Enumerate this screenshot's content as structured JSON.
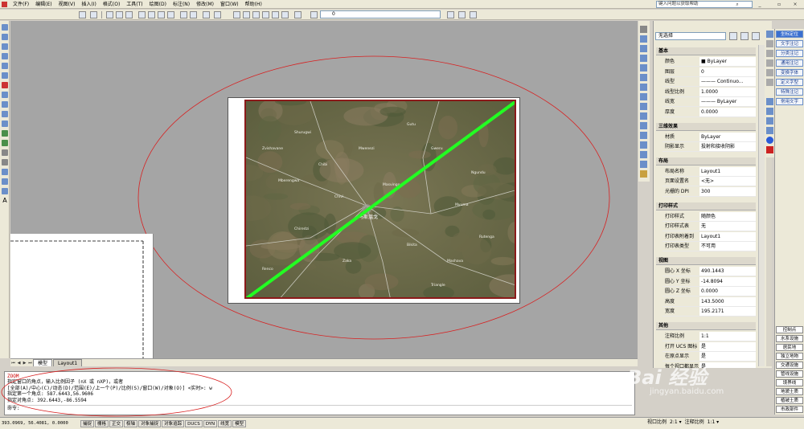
{
  "menu": {
    "items": [
      "文件(F)",
      "编辑(E)",
      "视图(V)",
      "插入(I)",
      "格式(O)",
      "工具(T)",
      "绘图(D)",
      "标注(N)",
      "修改(M)",
      "窗口(W)",
      "帮助(H)"
    ],
    "help_placeholder": "键入问题以获取帮助"
  },
  "toolbar": {
    "layer_value": "0"
  },
  "map": {
    "labels": [
      "Zvishavane",
      "Shurugwi",
      "Mberengwa",
      "Chivi",
      "Masvingo",
      "Gweru",
      "Mvuma",
      "Bikita",
      "Zaka",
      "Chiredzi",
      "Ngundu",
      "Renco",
      "Gutu",
      "Mashava",
      "Mwenezi",
      "Rutenga",
      "Chibi",
      "Triangle"
    ],
    "city_label": "马斯温戈",
    "line_color": "#22ff22",
    "frame_color": "#8b1a1a"
  },
  "props": {
    "selection": "无选择",
    "sections": {
      "basic": "基本",
      "3d": "三维效果",
      "layout": "布局",
      "plot": "打印样式",
      "view": "视图",
      "other": "其他"
    },
    "basic": [
      {
        "k": "颜色",
        "v": "■ ByLayer"
      },
      {
        "k": "图层",
        "v": "0"
      },
      {
        "k": "线型",
        "v": "——— Continuo..."
      },
      {
        "k": "线型比例",
        "v": "1.0000"
      },
      {
        "k": "线宽",
        "v": "——— ByLayer"
      },
      {
        "k": "厚度",
        "v": "0.0000"
      }
    ],
    "d3": [
      {
        "k": "材质",
        "v": "ByLayer"
      },
      {
        "k": "阴影显示",
        "v": "投射和接收阴影"
      }
    ],
    "layout": [
      {
        "k": "布局名称",
        "v": "Layout1"
      },
      {
        "k": "页面设置名",
        "v": "<无>"
      },
      {
        "k": "光栅的 DPI",
        "v": "300"
      }
    ],
    "plot": [
      {
        "k": "打印样式",
        "v": "随颜色"
      },
      {
        "k": "打印样式表",
        "v": "无"
      },
      {
        "k": "打印表附着到",
        "v": "Layout1"
      },
      {
        "k": "打印表类型",
        "v": "不可用"
      }
    ],
    "view": [
      {
        "k": "圆心 X 坐标",
        "v": "490.1443"
      },
      {
        "k": "圆心 Y 坐标",
        "v": "-14.8094"
      },
      {
        "k": "圆心 Z 坐标",
        "v": "0.0000"
      },
      {
        "k": "高度",
        "v": "143.5000"
      },
      {
        "k": "宽度",
        "v": "195.2171"
      }
    ],
    "other": [
      {
        "k": "注释比例",
        "v": "1:1"
      },
      {
        "k": "打开 UCS 图标",
        "v": "是"
      },
      {
        "k": "在原点显示",
        "v": "是"
      },
      {
        "k": "每个视口都显示",
        "v": "是"
      }
    ]
  },
  "palette": {
    "top": [
      "坐标定位",
      "文字注记",
      "分类注记",
      "通用注记",
      "变换字体",
      "定义字型",
      "特殊注记",
      "常用文字"
    ],
    "bottom": [
      "控制点",
      "水系设施",
      "居民地",
      "独立地物",
      "交通设施",
      "管线设施",
      "境界线",
      "地貌土质",
      "植被土质",
      "市政部件"
    ]
  },
  "tabs": [
    "模型",
    "Layout1"
  ],
  "cmd": {
    "lines": [
      "ZOOM",
      "指定窗口的角点，输入比例因子 (nX 或 nXP)，或者",
      "[全部(A)/中心(C)/动态(D)/范围(E)/上一个(P)/比例(S)/窗口(W)/对象(O)] <实时>: w",
      "指定第一个角点: 587.6443,56.9606",
      "指定对角点: 392.6443,-86.5594"
    ],
    "prompt": "命令:"
  },
  "status": {
    "coords": "393.0969, 56.4081, 0.0000",
    "toggles": [
      "捕捉",
      "栅格",
      "正交",
      "极轴",
      "对象捕捉",
      "对象追踪",
      "DUCS",
      "DYN",
      "线宽",
      "模型"
    ],
    "right": [
      "视口比例",
      "2:1 ▾",
      "注释比例",
      "1:1 ▾"
    ]
  },
  "watermark": {
    "main": "Bai 经验",
    "sub": "jingyan.baidu.com"
  }
}
